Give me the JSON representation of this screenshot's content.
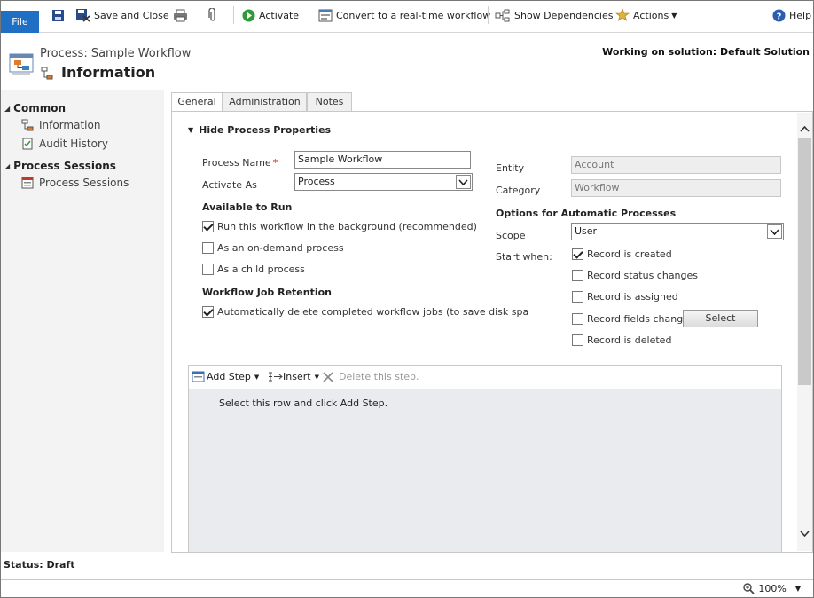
{
  "toolbar": {
    "file_label": "File",
    "save_close_label": "Save and Close",
    "activate_label": "Activate",
    "convert_label": "Convert to a real-time workflow",
    "dependencies_label": "Show Dependencies",
    "actions_label": "Actions",
    "help_label": "Help"
  },
  "header": {
    "entity_title": "Process: Sample Workflow",
    "page_title": "Information",
    "solution_text": "Working on solution: Default Solution"
  },
  "leftnav": {
    "groups": [
      {
        "label": "Common",
        "items": [
          {
            "label": "Information"
          },
          {
            "label": "Audit History"
          }
        ]
      },
      {
        "label": "Process Sessions",
        "items": [
          {
            "label": "Process Sessions"
          }
        ]
      }
    ]
  },
  "tabs": [
    {
      "label": "General",
      "active": true
    },
    {
      "label": "Administration",
      "active": false
    },
    {
      "label": "Notes",
      "active": false
    }
  ],
  "form": {
    "section_toggle": "Hide Process Properties",
    "process_name_label": "Process Name",
    "required_mark": "*",
    "process_name_value": "Sample Workflow",
    "activate_as_label": "Activate As",
    "activate_as_value": "Process",
    "available_heading": "Available to Run",
    "run_background_label": "Run this workflow in the background (recommended)",
    "on_demand_label": "As an on-demand process",
    "child_process_label": "As a child process",
    "retention_heading": "Workflow Job Retention",
    "auto_delete_label": "Automatically delete completed workflow jobs (to save disk spa",
    "entity_label": "Entity",
    "entity_value": "Account",
    "category_label": "Category",
    "category_value": "Workflow",
    "options_heading": "Options for Automatic Processes",
    "scope_label": "Scope",
    "scope_value": "User",
    "start_when_label": "Start when:",
    "record_created_label": "Record is created",
    "record_status_label": "Record status changes",
    "record_assigned_label": "Record is assigned",
    "record_fields_label": "Record fields change",
    "select_button_label": "Select",
    "record_deleted_label": "Record is deleted"
  },
  "steps": {
    "add_step_label": "Add Step",
    "insert_label": "Insert",
    "delete_label": "Delete this step.",
    "hint": "Select this row and click Add Step."
  },
  "footer": {
    "status": "Status: Draft",
    "zoom": "100%"
  },
  "colors": {
    "file_button": "#1f6fc5",
    "nav_background": "#f3f3f3",
    "designer_background": "#e9ebee"
  }
}
